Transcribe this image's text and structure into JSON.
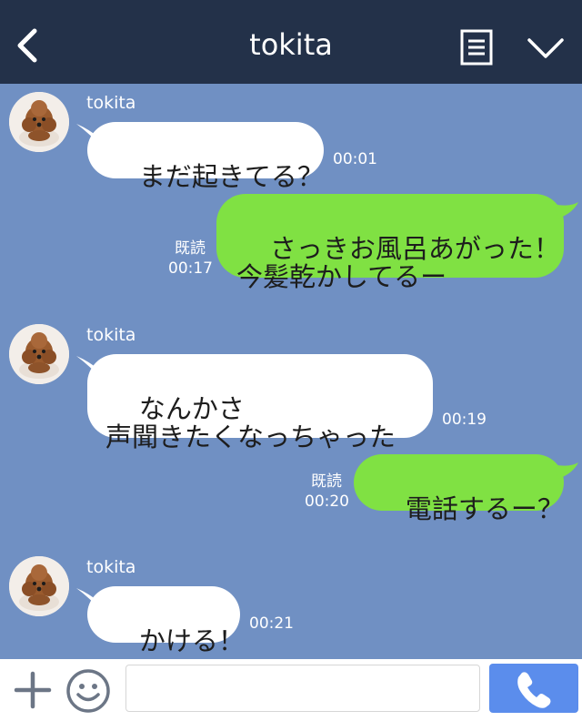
{
  "header": {
    "title": "tokita"
  },
  "colors": {
    "header_bg": "#233149",
    "chat_bg": "#7090c3",
    "incoming_bubble": "#ffffff",
    "outgoing_bubble": "#80e143",
    "call_button": "#5b8dec"
  },
  "messages": [
    {
      "direction": "in",
      "sender": "tokita",
      "text": "まだ起きてる？",
      "time": "00:01"
    },
    {
      "direction": "out",
      "text": "さっきお風呂あがった！\n今髪乾かしてるー",
      "read_label": "既読",
      "time": "00:17"
    },
    {
      "direction": "in",
      "sender": "tokita",
      "text": "なんかさ\n声聞きたくなっちゃった",
      "time": "00:19"
    },
    {
      "direction": "out",
      "text": "電話するー？",
      "read_label": "既読",
      "time": "00:20"
    },
    {
      "direction": "in",
      "sender": "tokita",
      "text": "かける！",
      "time": "00:21"
    }
  ],
  "footer": {
    "input_value": "",
    "input_placeholder": ""
  },
  "icons": {
    "back": "chevron-left-icon",
    "note": "note-icon",
    "menu": "chevron-down-icon",
    "plus": "plus-icon",
    "emoji": "smiley-icon",
    "call": "phone-icon"
  }
}
